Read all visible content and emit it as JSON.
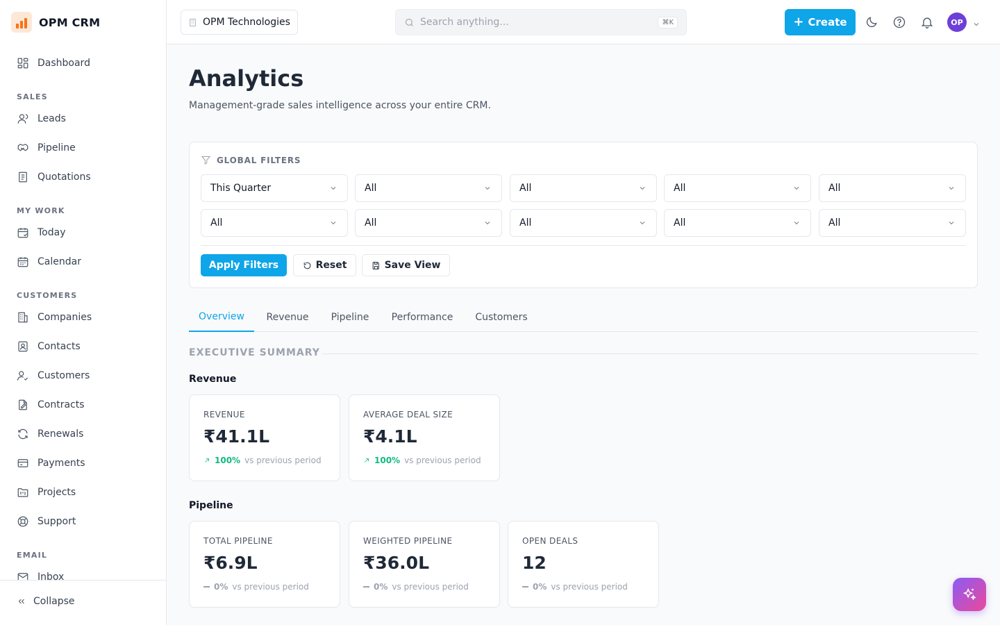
{
  "app": {
    "name": "OPM CRM"
  },
  "sidebar": {
    "items": [
      {
        "label": "Dashboard",
        "icon": "dashboard-icon"
      },
      {
        "label": "Leads",
        "icon": "user-icon"
      },
      {
        "label": "Pipeline",
        "icon": "handshake-icon"
      },
      {
        "label": "Quotations",
        "icon": "document-icon"
      },
      {
        "label": "Today",
        "icon": "calendar-check-icon"
      },
      {
        "label": "Calendar",
        "icon": "calendar-icon"
      },
      {
        "label": "Companies",
        "icon": "building-icon"
      },
      {
        "label": "Contacts",
        "icon": "contact-card-icon"
      },
      {
        "label": "Customers",
        "icon": "user-check-icon"
      },
      {
        "label": "Contracts",
        "icon": "file-signature-icon"
      },
      {
        "label": "Renewals",
        "icon": "refresh-icon"
      },
      {
        "label": "Payments",
        "icon": "credit-card-icon"
      },
      {
        "label": "Projects",
        "icon": "folder-kanban-icon"
      },
      {
        "label": "Support",
        "icon": "lifebuoy-icon"
      },
      {
        "label": "Inbox",
        "icon": "mail-icon"
      }
    ],
    "sections": [
      "SALES",
      "MY WORK",
      "CUSTOMERS",
      "EMAIL"
    ],
    "collapse_label": "Collapse"
  },
  "header": {
    "org": "OPM Technologies",
    "search_placeholder": "Search anything...",
    "shortcut": "⌘K",
    "create_label": "Create",
    "avatar_initials": "OP"
  },
  "page": {
    "title": "Analytics",
    "subtitle": "Management-grade sales intelligence across your entire CRM."
  },
  "filters": {
    "title": "GLOBAL FILTERS",
    "selects": [
      "This Quarter",
      "All",
      "All",
      "All",
      "All",
      "All",
      "All",
      "All",
      "All",
      "All"
    ],
    "apply_label": "Apply Filters",
    "reset_label": "Reset",
    "save_label": "Save View"
  },
  "tabs": [
    {
      "label": "Overview",
      "active": true
    },
    {
      "label": "Revenue",
      "active": false
    },
    {
      "label": "Pipeline",
      "active": false
    },
    {
      "label": "Performance",
      "active": false
    },
    {
      "label": "Customers",
      "active": false
    }
  ],
  "summary": {
    "title": "EXECUTIVE SUMMARY",
    "comparison_text": "vs previous period",
    "groups": [
      {
        "label": "Revenue",
        "cards": [
          {
            "label": "REVENUE",
            "value": "₹41.1L",
            "delta": "100%",
            "trend": "up"
          },
          {
            "label": "AVERAGE DEAL SIZE",
            "value": "₹4.1L",
            "delta": "100%",
            "trend": "up"
          }
        ]
      },
      {
        "label": "Pipeline",
        "cards": [
          {
            "label": "TOTAL PIPELINE",
            "value": "₹6.9L",
            "delta": "0%",
            "trend": "flat"
          },
          {
            "label": "WEIGHTED PIPELINE",
            "value": "₹36.0L",
            "delta": "0%",
            "trend": "flat"
          },
          {
            "label": "OPEN DEALS",
            "value": "12",
            "delta": "0%",
            "trend": "flat"
          }
        ]
      }
    ]
  },
  "colors": {
    "accent": "#0ea5e9",
    "positive": "#10b981",
    "avatar": "#6d3fd8"
  }
}
